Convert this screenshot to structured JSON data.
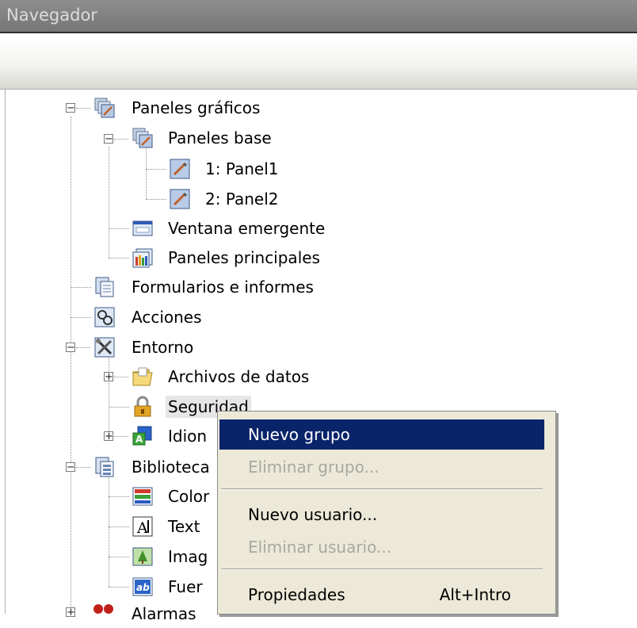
{
  "window": {
    "title": "Navegador"
  },
  "tree": [
    {
      "id": "paneles-graficos",
      "label": "Paneles gráficos"
    },
    {
      "id": "paneles-base",
      "label": "Paneles base"
    },
    {
      "id": "panel1",
      "label": "1: Panel1"
    },
    {
      "id": "panel2",
      "label": "2: Panel2"
    },
    {
      "id": "ventana-emergente",
      "label": "Ventana emergente"
    },
    {
      "id": "paneles-principales",
      "label": "Paneles principales"
    },
    {
      "id": "formularios",
      "label": "Formularios e informes"
    },
    {
      "id": "acciones",
      "label": "Acciones"
    },
    {
      "id": "entorno",
      "label": "Entorno"
    },
    {
      "id": "archivos-datos",
      "label": "Archivos de datos"
    },
    {
      "id": "seguridad",
      "label": "Seguridad"
    },
    {
      "id": "idiomas",
      "label": "Idion"
    },
    {
      "id": "biblioteca",
      "label": "Biblioteca"
    },
    {
      "id": "colores",
      "label": "Color"
    },
    {
      "id": "textos",
      "label": "Text"
    },
    {
      "id": "imagenes",
      "label": "Imag"
    },
    {
      "id": "fuentes",
      "label": "Fuer"
    },
    {
      "id": "alarmas",
      "label": "Alarmas"
    }
  ],
  "context_menu": {
    "items": [
      {
        "label": "Nuevo grupo",
        "state": "highlighted"
      },
      {
        "label": "Eliminar grupo...",
        "state": "disabled"
      },
      {
        "label": "Nuevo usuario...",
        "state": "enabled"
      },
      {
        "label": "Eliminar usuario...",
        "state": "disabled"
      },
      {
        "label": "Propiedades",
        "shortcut": "Alt+Intro",
        "state": "enabled"
      }
    ]
  },
  "colors": {
    "highlight": "#0a246a",
    "menu_bg": "#ece9d8",
    "disabled_text": "#a9a8a0"
  }
}
